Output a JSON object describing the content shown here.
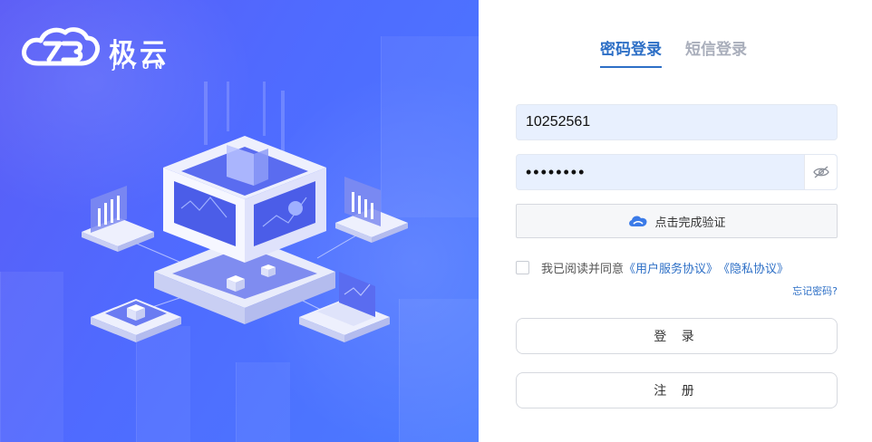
{
  "brand": {
    "name": "极云",
    "subtitle": "JIYUN"
  },
  "tabs": [
    {
      "label": "密码登录",
      "active": true
    },
    {
      "label": "短信登录",
      "active": false
    }
  ],
  "form": {
    "username_value": "10252561",
    "password_value": "********",
    "captcha_label": "点击完成验证",
    "agreement_checked": false,
    "agreement_prefix": "我已阅读并同意",
    "user_agreement_link": "《用户服务协议》",
    "privacy_link": "《隐私协议》",
    "forgot_password": "忘记密码?",
    "login_button": "登 录",
    "register_button": "注 册"
  },
  "colors": {
    "accent": "#2d6fc6",
    "panel_start": "#5b5cf6",
    "panel_end": "#4a7bff",
    "field_bg": "#e8f0fe"
  },
  "icons": {
    "eye": "eye-off-icon",
    "captcha": "shield-cloud-icon",
    "logo": "cloud-logo-icon"
  }
}
